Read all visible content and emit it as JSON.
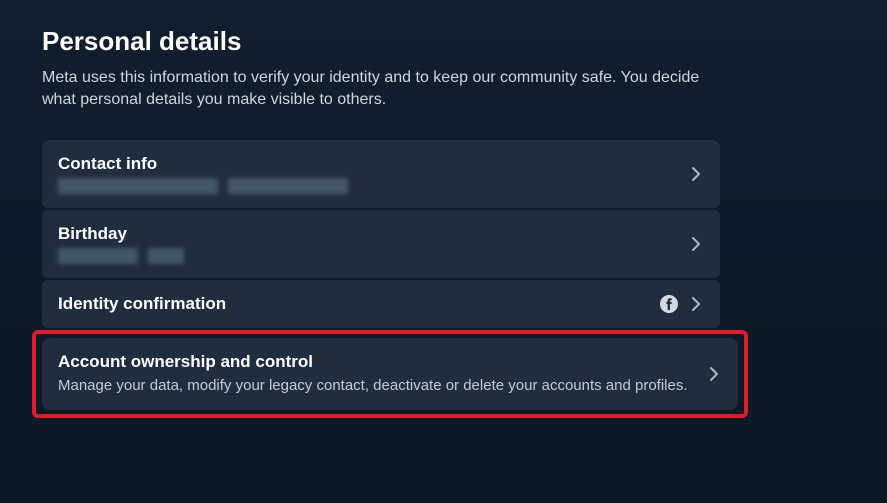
{
  "header": {
    "title": "Personal details",
    "subtitle": "Meta uses this information to verify your identity and to keep our community safe. You decide what personal details you make visible to others."
  },
  "items": {
    "contact": {
      "title": "Contact info"
    },
    "birthday": {
      "title": "Birthday"
    },
    "identity": {
      "title": "Identity confirmation"
    },
    "ownership": {
      "title": "Account ownership and control",
      "desc": "Manage your data, modify your legacy contact, deactivate or delete your accounts and profiles."
    }
  }
}
